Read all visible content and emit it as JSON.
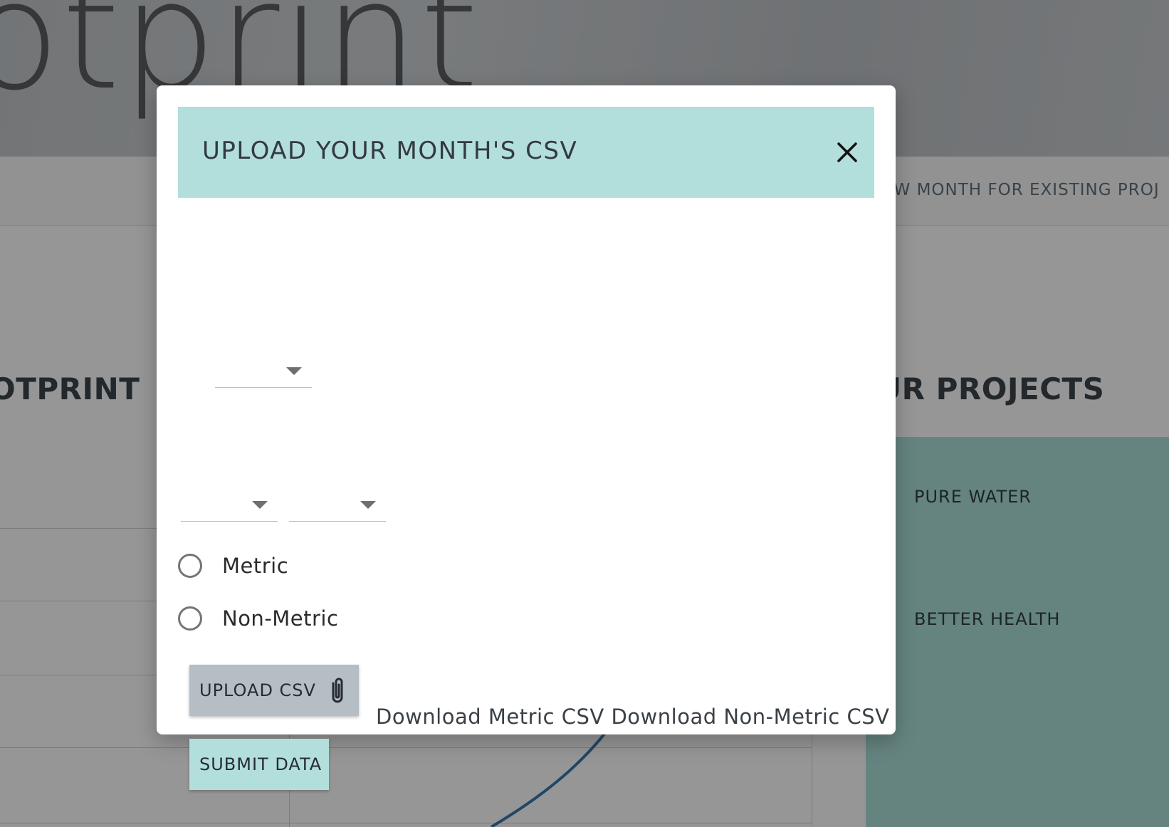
{
  "background": {
    "hero_word": "otprint",
    "subnav_link": "EW MONTH FOR EXISTING PROJ",
    "section_left_title": "OTPRINT",
    "section_right_title": "UR PROJECTS",
    "projects": [
      "PURE WATER",
      "BETTER HEALTH"
    ]
  },
  "modal": {
    "title": "UPLOAD YOUR MONTH'S CSV",
    "close_icon": "close-icon",
    "radio_options": [
      "Metric",
      "Non-Metric"
    ],
    "upload_button_label": "UPLOAD CSV",
    "upload_icon": "paperclip-icon",
    "submit_button_label": "SUBMIT DATA",
    "download_metric_label": "Download Metric CSV",
    "download_nonmetric_label": "Download Non-Metric CSV"
  },
  "colors": {
    "header_bg": "#b2dfdb",
    "upload_button_bg": "#b5bec4",
    "submit_button_bg": "#b2dfdb",
    "projects_panel_bg": "#a9dcd6",
    "chart_line": "#3a77a8"
  }
}
